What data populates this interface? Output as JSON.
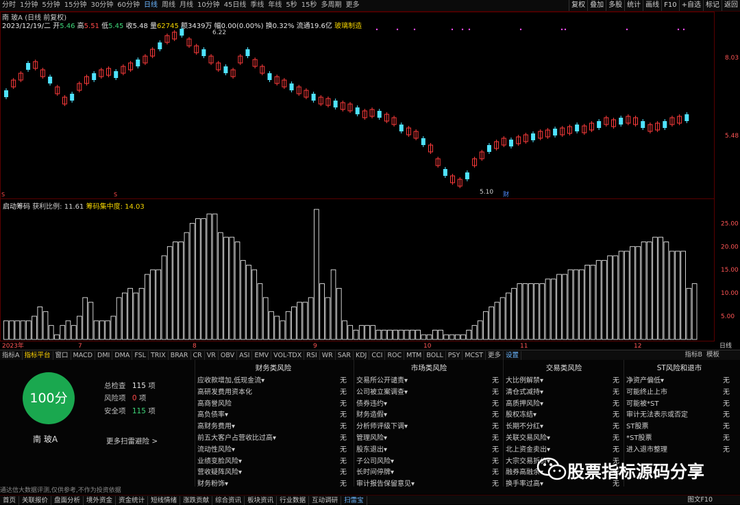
{
  "toolbar": {
    "periods": [
      "分时",
      "1分钟",
      "5分钟",
      "15分钟",
      "30分钟",
      "60分钟",
      "日线",
      "周线",
      "月线",
      "10分钟",
      "45日线",
      "季线",
      "年线",
      "5秒",
      "15秒",
      "多周期",
      "更多"
    ],
    "active_period": "日线",
    "right_items": [
      "复权",
      "叠加",
      "多股",
      "统计",
      "画线",
      "F10",
      "+自选",
      "标记",
      "返回"
    ]
  },
  "price_panel": {
    "title": "南 玻A (日线 前复权)",
    "date": "2023/12/19/二",
    "open_label": "开",
    "open": "5.46",
    "high_label": "高",
    "high": "5.51",
    "low_label": "低",
    "low": "5.45",
    "close_label": "收",
    "close": "5.48",
    "volume_label": "量",
    "volume": "62745",
    "amount_label": "额",
    "amount": "3439万",
    "change_label": "幅",
    "change": "0.00(0.00%)",
    "turnover_label": "换",
    "turnover": "0.32%",
    "float_label": "流通",
    "float": "19.6亿",
    "sector": "玻璃制造",
    "high_marker": "6.22",
    "low_marker": "5.10",
    "y_ticks": [
      "8.03",
      "5.48"
    ],
    "marker_cai": "财",
    "marker_s": "S"
  },
  "indicator_panel": {
    "name": "启动筹码",
    "profit_label": "获利比例:",
    "profit": "11.61",
    "conc_label": "筹码集中度:",
    "conc": "14.03",
    "y_ticks": [
      "25.00",
      "20.00",
      "15.00",
      "10.00",
      "5.00"
    ],
    "x_labels": [
      "2023年",
      "7",
      "8",
      "9",
      "10",
      "11",
      "12"
    ],
    "period_tag": "日线"
  },
  "chart_data": {
    "type": "bar",
    "title": "",
    "xlabel": "",
    "ylabel": "",
    "ylim": [
      0,
      28
    ],
    "values": [
      4,
      4,
      4,
      4,
      4,
      5,
      7,
      6,
      3,
      1,
      3,
      4,
      3,
      5,
      9,
      8,
      4,
      4,
      4,
      5,
      9,
      10,
      11,
      10,
      11,
      14,
      15,
      15,
      18,
      20,
      21,
      21,
      23,
      25,
      26,
      26,
      27,
      27,
      23,
      22,
      22,
      21,
      17,
      16,
      15,
      12,
      9,
      6,
      5,
      4,
      6,
      7,
      8,
      8,
      9,
      28,
      12,
      9,
      15,
      11,
      4,
      3,
      2,
      3,
      3,
      3,
      2,
      2,
      2,
      2,
      2,
      2,
      2,
      2,
      1,
      1,
      2,
      2,
      1,
      1,
      1,
      1,
      2,
      3,
      4,
      6,
      7,
      8,
      9,
      10,
      11,
      12,
      12,
      12,
      12,
      12,
      13,
      13,
      14,
      14,
      15,
      15,
      15,
      16,
      16,
      17,
      17,
      18,
      18,
      19,
      19,
      20,
      20,
      21,
      21,
      22,
      22,
      21,
      19,
      19,
      19,
      11,
      12
    ]
  },
  "tabs": {
    "items": [
      "指标A",
      "指标平台",
      "窗口",
      "MACD",
      "DMI",
      "DMA",
      "FSL",
      "TRIX",
      "BRAR",
      "CR",
      "VR",
      "OBV",
      "ASI",
      "EMV",
      "VOL-TDX",
      "RSI",
      "WR",
      "SAR",
      "KDJ",
      "CCI",
      "ROC",
      "MTM",
      "BOLL",
      "PSY",
      "MCST",
      "更多",
      "设置"
    ],
    "right": [
      "指标B",
      "模板"
    ]
  },
  "risk": {
    "score": "100分",
    "name": "南 玻A",
    "total_label": "总检查",
    "total": "115",
    "total_unit": "项",
    "risk_label": "风险项",
    "risk_count": "0",
    "risk_unit": "项",
    "safe_label": "安全项",
    "safe": "115",
    "safe_unit": "项",
    "more_link": "更多扫雷避险 >",
    "columns": [
      {
        "title": "财务类风险",
        "rows": [
          {
            "label": "应收款增加,低现金流▾",
            "val": "无"
          },
          {
            "label": "高研发费用资本化",
            "val": "无"
          },
          {
            "label": "高商誉风险",
            "val": "无"
          },
          {
            "label": "高负债率▾",
            "val": "无"
          },
          {
            "label": "高财务费用▾",
            "val": "无"
          },
          {
            "label": "前五大客户占营收比过高▾",
            "val": "无"
          },
          {
            "label": "流动性风险▾",
            "val": "无"
          },
          {
            "label": "业绩变脸风险▾",
            "val": "无"
          },
          {
            "label": "营收疑阵风险▾",
            "val": "无"
          },
          {
            "label": "财务粉饰▾",
            "val": "无"
          }
        ]
      },
      {
        "title": "市场类风险",
        "rows": [
          {
            "label": "交易所公开谴责▾",
            "val": "无"
          },
          {
            "label": "公司被立案调查▾",
            "val": "无"
          },
          {
            "label": "债券违约▾",
            "val": "无"
          },
          {
            "label": "财务造假▾",
            "val": "无"
          },
          {
            "label": "分析师评级下调▾",
            "val": "无"
          },
          {
            "label": "管理风险▾",
            "val": "无"
          },
          {
            "label": "股东退出▾",
            "val": "无"
          },
          {
            "label": "子公司风险▾",
            "val": "无"
          },
          {
            "label": "长时间停牌▾",
            "val": "无"
          },
          {
            "label": "审计报告保留意见▾",
            "val": "无"
          }
        ]
      },
      {
        "title": "交易类风险",
        "rows": [
          {
            "label": "大比例解禁▾",
            "val": "无"
          },
          {
            "label": "清仓式减持▾",
            "val": "无"
          },
          {
            "label": "高质押风险▾",
            "val": "无"
          },
          {
            "label": "股权冻结▾",
            "val": "无"
          },
          {
            "label": "长期不分红▾",
            "val": "无"
          },
          {
            "label": "关联交易风险▾",
            "val": "无"
          },
          {
            "label": "北上资金卖出▾",
            "val": "无"
          },
          {
            "label": "大宗交易折价▾",
            "val": "无"
          },
          {
            "label": "融券高融余▾",
            "val": "无"
          },
          {
            "label": "换手率过高▾",
            "val": "无"
          }
        ]
      },
      {
        "title": "ST风险和退市",
        "rows": [
          {
            "label": "净资产偏低▾",
            "val": "无"
          },
          {
            "label": "可能终止上市",
            "val": "无"
          },
          {
            "label": "可能被*ST",
            "val": "无"
          },
          {
            "label": "审计无法表示或否定",
            "val": "无"
          },
          {
            "label": "ST股票",
            "val": "无"
          },
          {
            "label": "*ST股票",
            "val": "无"
          },
          {
            "label": "进入退市整理",
            "val": "无"
          }
        ]
      }
    ],
    "disclaimer": "通达信大数据评测,仅供参考,不作为投资依据"
  },
  "statusbar": {
    "items": [
      "首页",
      "关联报价",
      "盘面分析",
      "境外资金",
      "资金统计",
      "短线情绪",
      "涨跌贡献",
      "综合资讯",
      "板块资讯",
      "行业数据",
      "互动调研",
      "扫雷宝"
    ],
    "active": "扫雷宝",
    "right": "图文F10"
  },
  "watermark": {
    "text": "股票指标源码分享"
  },
  "colors": {
    "up": "#ff3b3b",
    "down": "#4fe3ff",
    "bg": "#000000",
    "score": "#1aa84f"
  }
}
